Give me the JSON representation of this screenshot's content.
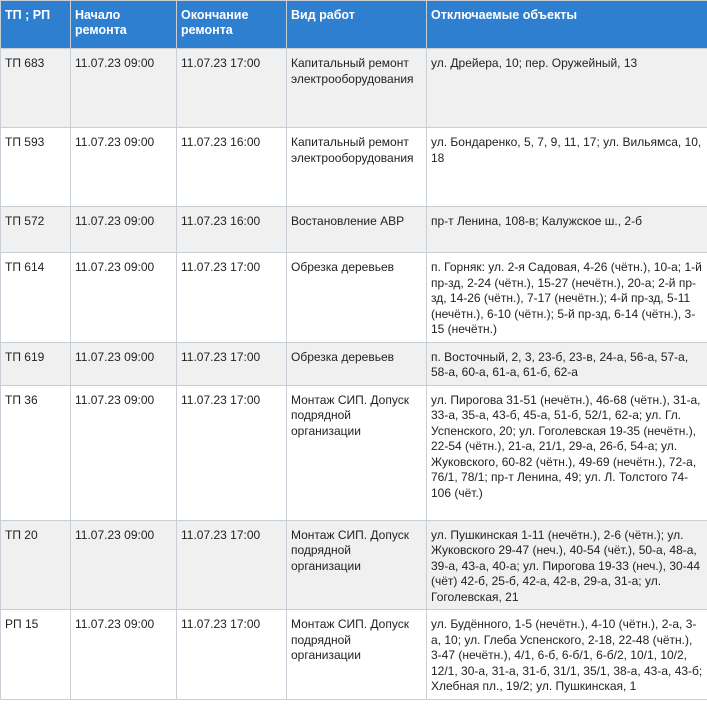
{
  "table": {
    "headers": [
      "ТП ; РП",
      "Начало ремонта",
      "Окончание ремонта",
      "Вид работ",
      "Отключаемые объекты"
    ],
    "rows": [
      {
        "tp": "ТП 683",
        "start": "11.07.23 09:00",
        "end": "11.07.23 17:00",
        "work": "Капитальный ремонт электрооборудования",
        "objects": "ул. Дрейера, 10; пер. Оружейный, 13"
      },
      {
        "tp": "ТП 593",
        "start": "11.07.23 09:00",
        "end": "11.07.23 16:00",
        "work": "Капитальный ремонт электрооборудования",
        "objects": "ул. Бондаренко, 5, 7, 9, 11, 17; ул. Вильямса, 10, 18"
      },
      {
        "tp": "ТП 572",
        "start": "11.07.23 09:00",
        "end": "11.07.23 16:00",
        "work": "Востановление АВР",
        "objects": "пр-т Ленина, 108-в; Калужское ш., 2-б"
      },
      {
        "tp": "ТП 614",
        "start": "11.07.23 09:00",
        "end": "11.07.23 17:00",
        "work": "Обрезка деревьев",
        "objects": "п. Горняк: ул. 2-я Садовая, 4-26 (чётн.), 10-а; 1-й пр-зд, 2-24 (чётн.), 15-27 (нечётн.), 20-а; 2-й пр-зд, 14-26 (чётн.), 7-17 (нечётн.); 4-й пр-зд, 5-11 (нечётн.), 6-10 (чётн.); 5-й пр-зд, 6-14 (чётн.), 3-15 (нечётн.)"
      },
      {
        "tp": "ТП 619",
        "start": "11.07.23 09:00",
        "end": "11.07.23 17:00",
        "work": "Обрезка деревьев",
        "objects": "п. Восточный, 2, 3, 23-б, 23-в, 24-а, 56-а, 57-а, 58-а, 60-а, 61-а, 61-б, 62-а"
      },
      {
        "tp": "ТП 36",
        "start": "11.07.23 09:00",
        "end": "11.07.23 17:00",
        "work": "Монтаж СИП. Допуск подрядной организации",
        "objects": "ул. Пирогова 31-51 (нечётн.), 46-68 (чётн.), 31-а, 33-а, 35-а, 43-б, 45-а, 51-б, 52/1, 62-а; ул. Гл. Успенского, 20; ул. Гоголевская 19-35 (нечётн.), 22-54 (чётн.), 21-а, 21/1, 29-а, 26-б, 54-а; ул. Жуковского, 60-82 (чётн.), 49-69 (нечётн.), 72-а, 76/1, 78/1; пр-т Ленина, 49; ул. Л. Толстого 74-106 (чёт.)"
      },
      {
        "tp": "ТП 20",
        "start": "11.07.23 09:00",
        "end": "11.07.23 17:00",
        "work": "Монтаж СИП. Допуск подрядной организации",
        "objects": "ул. Пушкинская 1-11 (нечётн.), 2-6 (чётн.); ул. Жуковского 29-47 (неч.), 40-54 (чёт.), 50-а, 48-а, 39-а, 43-а, 40-а; ул. Пирогова 19-33 (неч.), 30-44 (чёт) 42-б, 25-б, 42-а, 42-в, 29-а, 31-а; ул. Гоголевская, 21"
      },
      {
        "tp": "РП 15",
        "start": "11.07.23 09:00",
        "end": "11.07.23 17:00",
        "work": "Монтаж СИП. Допуск подрядной организации",
        "objects": "ул. Будённого, 1-5 (нечётн.), 4-10 (чётн.), 2-а, 3-а, 10; ул. Глеба Успенского, 2-18, 22-48 (чётн.), 3-47 (нечётн.), 4/1, 6-б, 6-б/1, 6-б/2, 10/1, 10/2, 12/1, 30-а, 31-а, 31-б, 31/1, 35/1, 38-а, 43-а, 43-б; Хлебная пл., 19/2; ул. Пушкинская, 1"
      }
    ]
  }
}
